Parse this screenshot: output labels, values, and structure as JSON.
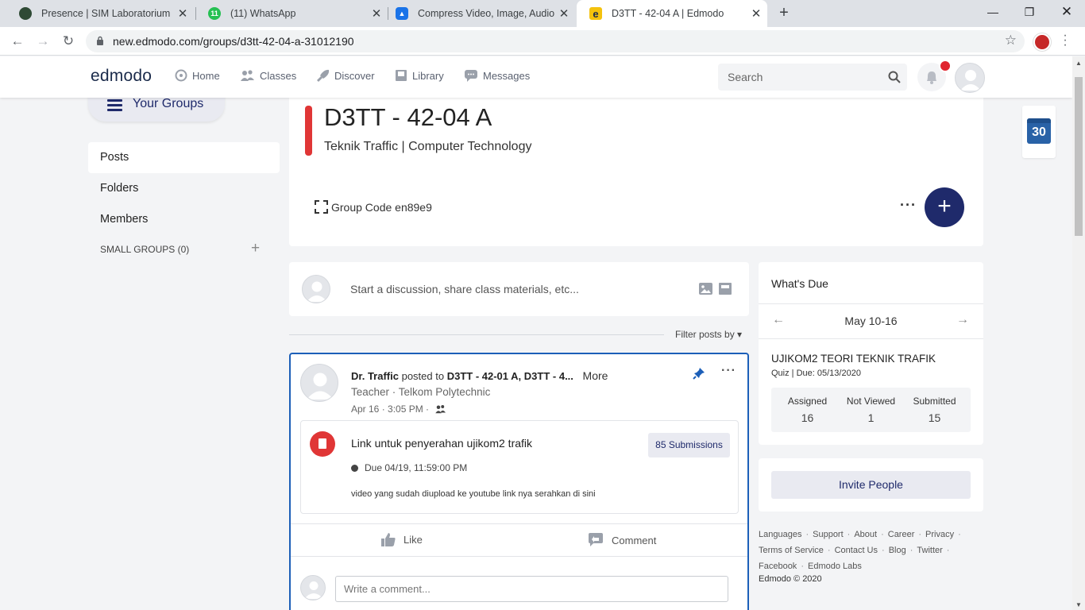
{
  "browser": {
    "tabs": [
      {
        "title": "Presence | SIM Laboratorium",
        "favicon": "leaf-icon",
        "active": false
      },
      {
        "title": "(11) WhatsApp",
        "favicon": "whatsapp-icon",
        "badge": "11",
        "active": false
      },
      {
        "title": "Compress Video, Image, Audio a",
        "favicon": "cloud-upload-icon",
        "active": false
      },
      {
        "title": "D3TT - 42-04 A | Edmodo",
        "favicon": "edmodo-e-icon",
        "active": true
      }
    ],
    "url": "new.edmodo.com/groups/d3tt-42-04-a-31012190"
  },
  "nav": {
    "logo": "edmodo",
    "items": [
      "Home",
      "Classes",
      "Discover",
      "Library",
      "Messages"
    ],
    "search_placeholder": "Search"
  },
  "sidebar": {
    "your_groups": "Your Groups",
    "items": [
      "Posts",
      "Folders",
      "Members"
    ],
    "small_groups": "SMALL GROUPS (0)",
    "add": "+"
  },
  "group": {
    "title": "D3TT - 42-04 A",
    "subtitle": "Teknik Traffic | Computer Technology",
    "code_label": "Group Code en89e9",
    "more": "···",
    "fab": "+"
  },
  "composer": {
    "placeholder": "Start a discussion, share class materials, etc..."
  },
  "filter": {
    "label": "Filter posts by ▾"
  },
  "post": {
    "author": "Dr. Traffic",
    "posted_to": "posted to",
    "group1": "D3TT - 42-01 A,",
    "group2": "D3TT - 4...",
    "more": "More",
    "role": "Teacher · Telkom Polytechnic",
    "time": "Apr 16 · 3:05 PM  ·",
    "dots": "···",
    "assignment": {
      "title": "Link untuk penyerahan ujikom2 trafik",
      "due": "Due 04/19, 11:59:00 PM",
      "description": "video yang sudah diupload ke youtube link nya serahkan di sini",
      "submissions": "85 Submissions"
    },
    "like": "Like",
    "comment": "Comment",
    "comment_placeholder": "Write a comment..."
  },
  "whats_due": {
    "header": "What's Due",
    "range": "May 10-16",
    "quiz_title": "UJIKOM2 TEORI TEKNIK TRAFIK",
    "quiz_meta": "Quiz | Due: 05/13/2020",
    "stats": [
      {
        "label": "Assigned",
        "value": "16"
      },
      {
        "label": "Not Viewed",
        "value": "1"
      },
      {
        "label": "Submitted",
        "value": "15"
      }
    ]
  },
  "invite": {
    "label": "Invite People"
  },
  "footer": {
    "row1": [
      "Languages",
      "Support",
      "About",
      "Career",
      "Privacy"
    ],
    "row2": [
      "Terms of Service",
      "Contact Us",
      "Blog",
      "Twitter"
    ],
    "row3": [
      "Facebook",
      "Edmodo Labs"
    ],
    "copyright": "Edmodo © 2020"
  },
  "calendar_widget": {
    "day": "30"
  },
  "colors": {
    "brand_navy": "#1f2a6b",
    "accent_red": "#e03636",
    "post_border": "#1c5fb8"
  }
}
